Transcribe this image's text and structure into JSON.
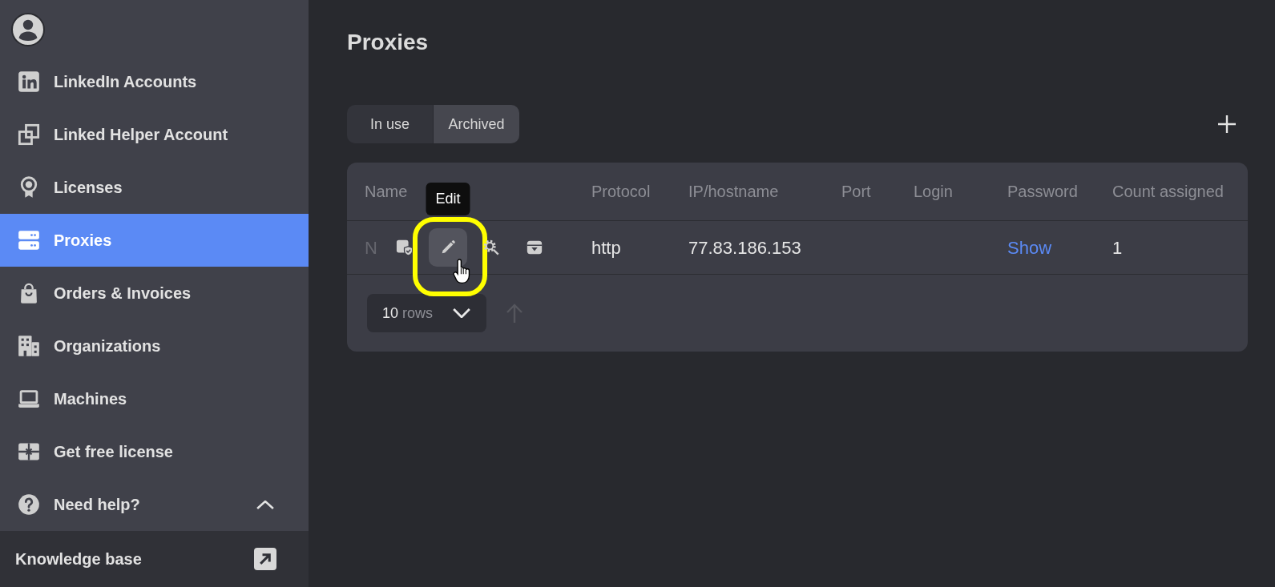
{
  "sidebar": {
    "items": [
      {
        "label": "LinkedIn Accounts",
        "selected": false
      },
      {
        "label": "Linked Helper Account",
        "selected": false
      },
      {
        "label": "Licenses",
        "selected": false
      },
      {
        "label": "Proxies",
        "selected": true
      },
      {
        "label": "Orders & Invoices",
        "selected": false
      },
      {
        "label": "Organizations",
        "selected": false
      },
      {
        "label": "Machines",
        "selected": false
      },
      {
        "label": "Get free license",
        "selected": false
      }
    ],
    "help": {
      "label": "Need help?",
      "expanded": true
    },
    "footer_link": {
      "label": "Knowledge base"
    }
  },
  "page_title": "Proxies",
  "tabs": [
    {
      "label": "In use",
      "selected": false
    },
    {
      "label": "Archived",
      "selected": true
    }
  ],
  "table": {
    "columns": [
      "Name",
      "Protocol",
      "IP/hostname",
      "Port",
      "Login",
      "Password",
      "Count assigned"
    ],
    "rows": [
      {
        "name": "N",
        "actions": [
          {
            "hovered": false
          },
          {
            "hovered": true,
            "highlighted": true,
            "tooltip": "Edit"
          },
          {
            "hovered": false
          },
          {
            "hovered": false
          }
        ],
        "protocol": "http",
        "ip_hostname": "77.83.186.153",
        "password": "Show",
        "count_assigned": "1"
      }
    ]
  },
  "pagination": {
    "rows_per_page": "10",
    "unit": "rows"
  }
}
